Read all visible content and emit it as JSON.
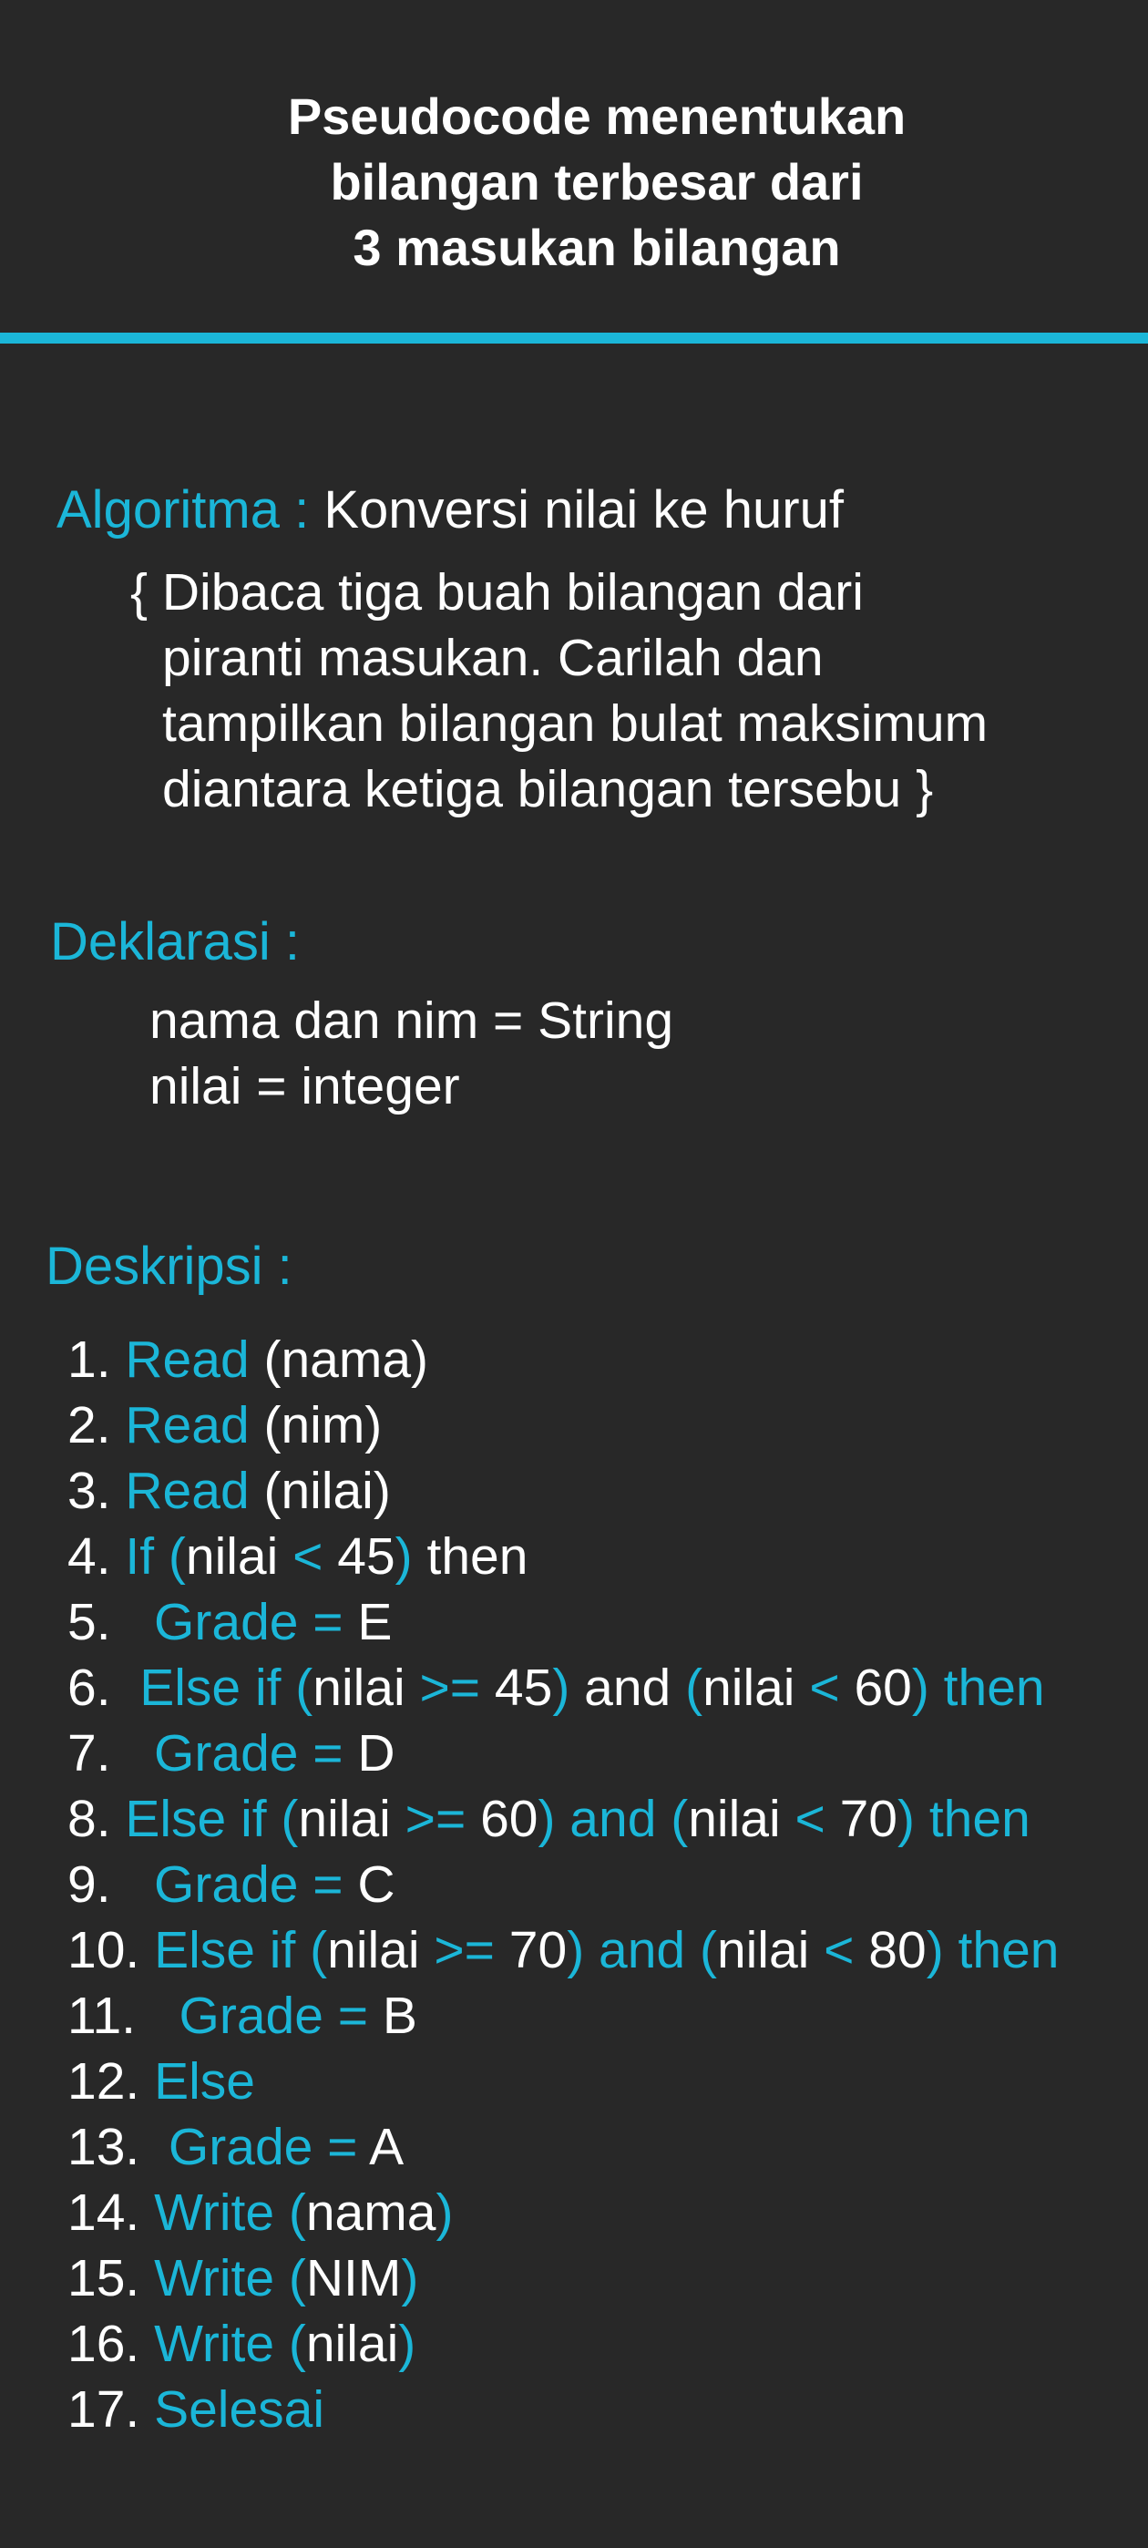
{
  "title": "Pseudocode menentukan\nbilangan terbesar dari\n3 masukan bilangan",
  "algoritma": {
    "label": "Algoritma : ",
    "value": "Konversi nilai ke huruf",
    "description_lines": [
      "{ Dibaca tiga buah bilangan dari",
      "piranti masukan. Carilah dan",
      "tampilkan bilangan bulat maksimum",
      "diantara ketiga bilangan tersebu }"
    ]
  },
  "deklarasi": {
    "label": "Deklarasi :",
    "lines": [
      "nama dan nim = String",
      "nilai = integer"
    ]
  },
  "deskripsi": {
    "label": "Deskripsi :",
    "steps": [
      [
        {
          "t": "1. ",
          "c": "w"
        },
        {
          "t": "Read",
          "c": "c"
        },
        {
          "t": " (nama)",
          "c": "w"
        }
      ],
      [
        {
          "t": "2. ",
          "c": "w"
        },
        {
          "t": "Read",
          "c": "c"
        },
        {
          "t": " (nim)",
          "c": "w"
        }
      ],
      [
        {
          "t": "3. ",
          "c": "w"
        },
        {
          "t": "Read",
          "c": "c"
        },
        {
          "t": " (nilai)",
          "c": "w"
        }
      ],
      [
        {
          "t": "4. ",
          "c": "w"
        },
        {
          "t": "If (",
          "c": "c"
        },
        {
          "t": "nilai ",
          "c": "w"
        },
        {
          "t": "<",
          "c": "c"
        },
        {
          "t": " 45",
          "c": "w"
        },
        {
          "t": ")",
          "c": "c"
        },
        {
          "t": " then",
          "c": "w"
        }
      ],
      [
        {
          "t": "5.   ",
          "c": "w"
        },
        {
          "t": "Grade =",
          "c": "c"
        },
        {
          "t": " E",
          "c": "w"
        }
      ],
      [
        {
          "t": "6.  ",
          "c": "w"
        },
        {
          "t": "Else if (",
          "c": "c"
        },
        {
          "t": "nilai ",
          "c": "w"
        },
        {
          "t": ">=",
          "c": "c"
        },
        {
          "t": " 45",
          "c": "w"
        },
        {
          "t": ")",
          "c": "c"
        },
        {
          "t": " and ",
          "c": "w"
        },
        {
          "t": "(",
          "c": "c"
        },
        {
          "t": "nilai ",
          "c": "w"
        },
        {
          "t": "<",
          "c": "c"
        },
        {
          "t": " 60",
          "c": "w"
        },
        {
          "t": ") then",
          "c": "c"
        }
      ],
      [
        {
          "t": "7.   ",
          "c": "w"
        },
        {
          "t": "Grade =",
          "c": "c"
        },
        {
          "t": " D",
          "c": "w"
        }
      ],
      [
        {
          "t": "8. ",
          "c": "w"
        },
        {
          "t": "Else if (",
          "c": "c"
        },
        {
          "t": "nilai ",
          "c": "w"
        },
        {
          "t": ">=",
          "c": "c"
        },
        {
          "t": " 60",
          "c": "w"
        },
        {
          "t": ") and (",
          "c": "c"
        },
        {
          "t": "nilai ",
          "c": "w"
        },
        {
          "t": "<",
          "c": "c"
        },
        {
          "t": " 70",
          "c": "w"
        },
        {
          "t": ") then",
          "c": "c"
        }
      ],
      [
        {
          "t": "9.   ",
          "c": "w"
        },
        {
          "t": "Grade =",
          "c": "c"
        },
        {
          "t": " C",
          "c": "w"
        }
      ],
      [
        {
          "t": "10. ",
          "c": "w"
        },
        {
          "t": "Else if (",
          "c": "c"
        },
        {
          "t": "nilai ",
          "c": "w"
        },
        {
          "t": ">=",
          "c": "c"
        },
        {
          "t": " 70",
          "c": "w"
        },
        {
          "t": ") and (",
          "c": "c"
        },
        {
          "t": "nilai ",
          "c": "w"
        },
        {
          "t": "<",
          "c": "c"
        },
        {
          "t": " 80",
          "c": "w"
        },
        {
          "t": ") then",
          "c": "c"
        }
      ],
      [
        {
          "t": "11.   ",
          "c": "w"
        },
        {
          "t": "Grade =",
          "c": "c"
        },
        {
          "t": " B",
          "c": "w"
        }
      ],
      [
        {
          "t": "12. ",
          "c": "w"
        },
        {
          "t": "Else",
          "c": "c"
        }
      ],
      [
        {
          "t": "13.  ",
          "c": "w"
        },
        {
          "t": "Grade =",
          "c": "c"
        },
        {
          "t": " A",
          "c": "w"
        }
      ],
      [
        {
          "t": "14. ",
          "c": "w"
        },
        {
          "t": "Write (",
          "c": "c"
        },
        {
          "t": "nama",
          "c": "w"
        },
        {
          "t": ")",
          "c": "c"
        }
      ],
      [
        {
          "t": "15. ",
          "c": "w"
        },
        {
          "t": "Write (",
          "c": "c"
        },
        {
          "t": "NIM",
          "c": "w"
        },
        {
          "t": ")",
          "c": "c"
        }
      ],
      [
        {
          "t": "16. ",
          "c": "w"
        },
        {
          "t": "Write (",
          "c": "c"
        },
        {
          "t": "nilai",
          "c": "w"
        },
        {
          "t": ")",
          "c": "c"
        }
      ],
      [
        {
          "t": "17. ",
          "c": "w"
        },
        {
          "t": "Selesai",
          "c": "c"
        }
      ]
    ]
  },
  "colors": {
    "background": "#282828",
    "accent": "#1bb6d8",
    "text": "#ffffff"
  }
}
